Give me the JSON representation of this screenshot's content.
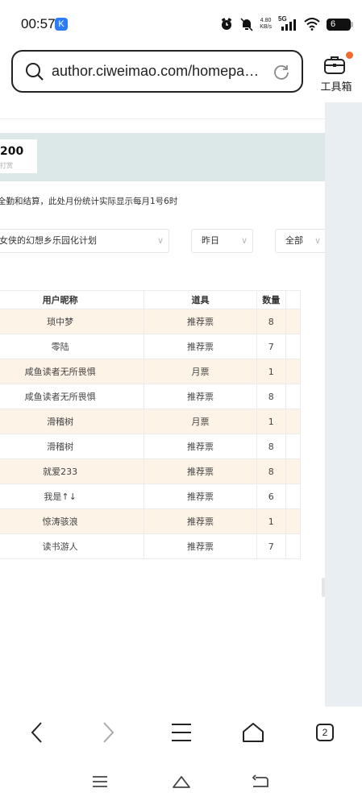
{
  "status_bar": {
    "time": "00:57",
    "app_badge": "K",
    "net_speed_value": "4.80",
    "net_speed_unit": "KB/s",
    "network": "5G",
    "battery": "6"
  },
  "url_bar": {
    "url": "author.ciweimao.com/homepa…"
  },
  "toolbox": {
    "label": "工具箱",
    "badge_color": "#f26b2f"
  },
  "page": {
    "stat_value": "200",
    "stat_caption": "打赏",
    "notice": "全勤和结算，此处月份统计实际显示每月1号6时",
    "filters": {
      "book": "女侠的幻想乡乐园化计划",
      "period": "昨日",
      "type": "全部"
    },
    "table": {
      "columns": [
        "用户昵称",
        "道具",
        "数量"
      ],
      "rows": [
        {
          "user": "琐中梦",
          "item": "推荐票",
          "count": "8"
        },
        {
          "user": "零陆",
          "item": "推荐票",
          "count": "7"
        },
        {
          "user": "咸鱼读者无所畏惧",
          "item": "月票",
          "count": "1"
        },
        {
          "user": "咸鱼读者无所畏惧",
          "item": "推荐票",
          "count": "8"
        },
        {
          "user": "滑稽树",
          "item": "月票",
          "count": "1"
        },
        {
          "user": "滑稽树",
          "item": "推荐票",
          "count": "8"
        },
        {
          "user": "就爱233",
          "item": "推荐票",
          "count": "8"
        },
        {
          "user": "我是↑↓",
          "item": "推荐票",
          "count": "6"
        },
        {
          "user": "惊涛骇浪",
          "item": "推荐票",
          "count": "1"
        },
        {
          "user": "读书游人",
          "item": "推荐票",
          "count": "7"
        }
      ]
    },
    "colors": {
      "header_band": "#dce7e8",
      "alt_row": "#fdf3e6",
      "side_panel": "#e9eef3"
    }
  },
  "browser_nav": {
    "tab_count": "2",
    "icons": [
      "back-icon",
      "forward-icon",
      "menu-icon",
      "home-icon",
      "tabs-icon"
    ]
  },
  "system_nav": {
    "icons": [
      "recent-apps-icon",
      "home-icon",
      "back-icon"
    ]
  }
}
